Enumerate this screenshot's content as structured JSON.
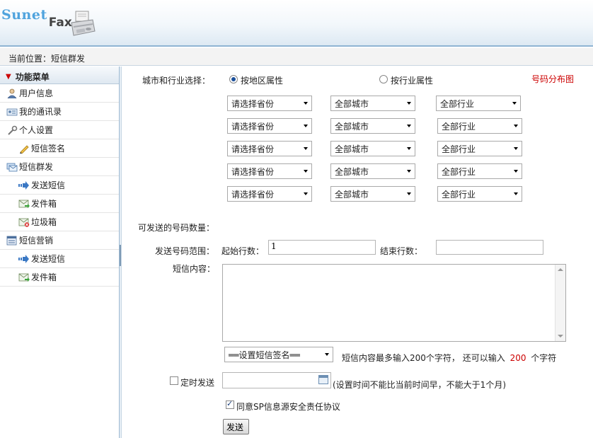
{
  "header": {
    "logo_part1": "Sunet",
    "logo_part2": "Fax"
  },
  "breadcrumb": {
    "text": "当前位置：短信群发"
  },
  "sidebar": {
    "title": "功能菜单",
    "items": [
      {
        "label": "用户信息",
        "icon": "user-icon"
      },
      {
        "label": "我的通讯录",
        "icon": "contacts-card-icon"
      },
      {
        "label": "个人设置",
        "icon": "wrench-icon"
      },
      {
        "label": "短信签名",
        "icon": "pencil-icon"
      },
      {
        "label": "短信群发",
        "icon": "sms-group-icon"
      },
      {
        "label": "发送短信",
        "icon": "send-arrow-icon"
      },
      {
        "label": "发件箱",
        "icon": "outbox-icon"
      },
      {
        "label": "垃圾箱",
        "icon": "trash-icon"
      },
      {
        "label": "短信营销",
        "icon": "marketing-list-icon"
      },
      {
        "label": "发送短信",
        "icon": "send-arrow-icon"
      },
      {
        "label": "发件箱",
        "icon": "outbox-icon"
      }
    ]
  },
  "filter": {
    "label": "城市和行业选择：",
    "option_region": "按地区属性",
    "option_industry": "按行业属性",
    "selected": "region",
    "map_link": "号码分布图",
    "rows": [
      {
        "province": "请选择省份",
        "city": "全部城市",
        "industry": "全部行业"
      },
      {
        "province": "请选择省份",
        "city": "全部城市",
        "industry": "全部行业"
      },
      {
        "province": "请选择省份",
        "city": "全部城市",
        "industry": "全部行业"
      },
      {
        "province": "请选择省份",
        "city": "全部城市",
        "industry": "全部行业"
      },
      {
        "province": "请选择省份",
        "city": "全部城市",
        "industry": "全部行业"
      }
    ]
  },
  "count": {
    "label": "可发送的号码数量："
  },
  "range": {
    "label": "发送号码范围：",
    "start_label": "起始行数：",
    "start_value": "1",
    "end_label": "结束行数：",
    "end_value": ""
  },
  "message": {
    "label": "短信内容：",
    "value": "",
    "signature_select": "══设置短信签名══",
    "hint_prefix": "短信内容最多输入200个字符，  还可以输入",
    "remaining": "200",
    "hint_suffix": "个字符"
  },
  "schedule": {
    "label": "定时发送",
    "checked": false,
    "value": "",
    "note": "(设置时间不能比当前时间早，不能大于1个月)"
  },
  "agreement": {
    "label": "同意SP信息源安全责任协议",
    "checked": true
  },
  "submit": {
    "label": "发送"
  },
  "colors": {
    "accent_red": "#cc0000",
    "header_border": "#8fb4d3"
  }
}
